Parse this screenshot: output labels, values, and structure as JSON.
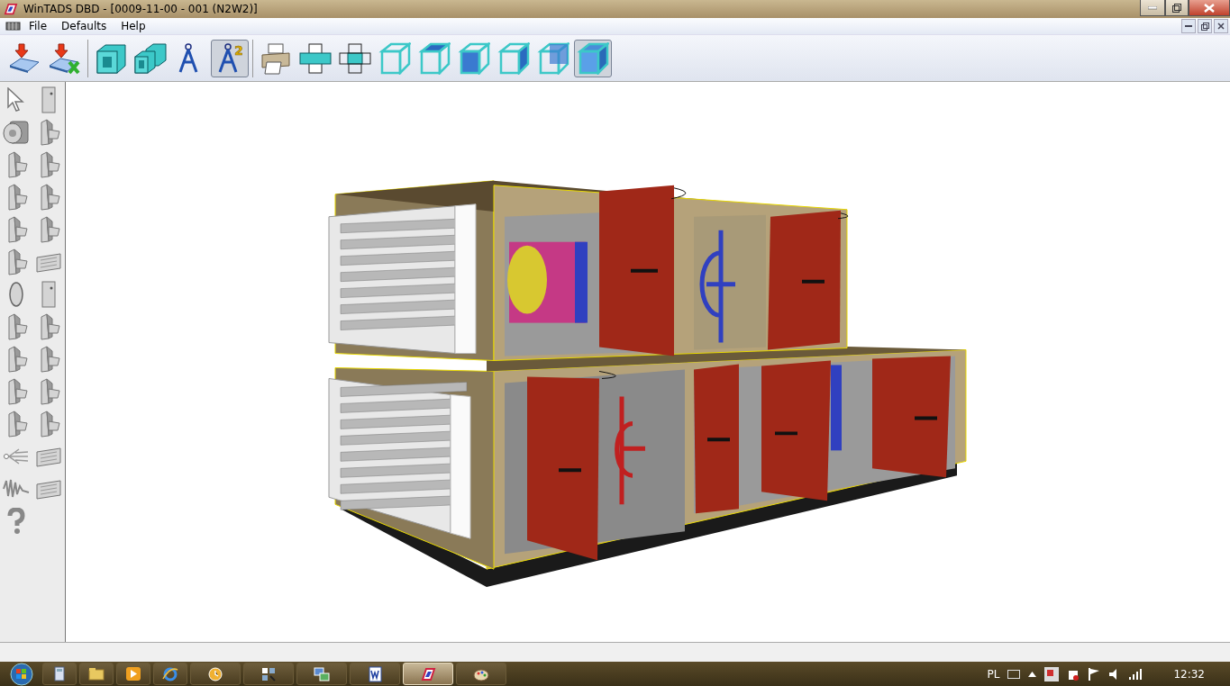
{
  "window": {
    "title": "WinTADS DBD - [0009-11-00 - 001 (N2W2)]"
  },
  "menu": [
    "File",
    "Defaults",
    "Help"
  ],
  "toolbar": {
    "groups": [
      [
        {
          "kind": "save",
          "selected": false
        },
        {
          "kind": "save-cancel",
          "selected": false
        }
      ],
      [
        {
          "kind": "duct",
          "selected": false
        },
        {
          "kind": "duct-double",
          "selected": false
        },
        {
          "kind": "compass",
          "selected": false
        },
        {
          "kind": "compass-badge",
          "badge": "2",
          "selected": true
        }
      ],
      [
        {
          "kind": "print",
          "selected": false
        },
        {
          "kind": "flat-section",
          "selected": false
        },
        {
          "kind": "flat-section-outline",
          "selected": false
        },
        {
          "kind": "wire-box",
          "selected": false
        },
        {
          "kind": "wire-box-top",
          "selected": false
        },
        {
          "kind": "wire-box-front",
          "selected": false
        },
        {
          "kind": "wire-box-side",
          "selected": false
        },
        {
          "kind": "wire-box-back",
          "selected": false
        },
        {
          "kind": "solid-box",
          "selected": true
        }
      ]
    ]
  },
  "palette": [
    {
      "kind": "pointer"
    },
    {
      "kind": "door"
    },
    {
      "kind": "fan"
    },
    {
      "kind": "section"
    },
    {
      "kind": "section"
    },
    {
      "kind": "section"
    },
    {
      "kind": "section"
    },
    {
      "kind": "section"
    },
    {
      "kind": "section"
    },
    {
      "kind": "section"
    },
    {
      "kind": "section"
    },
    {
      "kind": "plate"
    },
    {
      "kind": "disc"
    },
    {
      "kind": "door"
    },
    {
      "kind": "section"
    },
    {
      "kind": "section"
    },
    {
      "kind": "section"
    },
    {
      "kind": "section"
    },
    {
      "kind": "section"
    },
    {
      "kind": "section"
    },
    {
      "kind": "section"
    },
    {
      "kind": "section"
    },
    {
      "kind": "spray"
    },
    {
      "kind": "plate"
    },
    {
      "kind": "wave"
    },
    {
      "kind": "plate"
    },
    {
      "kind": "help"
    }
  ],
  "taskbar": {
    "apps": [
      {
        "kind": "calculator",
        "selected": false
      },
      {
        "kind": "folder",
        "selected": false
      },
      {
        "kind": "media",
        "selected": false
      },
      {
        "kind": "browser",
        "selected": false
      },
      {
        "kind": "clock",
        "selected": false
      },
      {
        "kind": "grid",
        "selected": false
      },
      {
        "kind": "network",
        "selected": false
      },
      {
        "kind": "document",
        "selected": false
      },
      {
        "kind": "wintads",
        "selected": true
      },
      {
        "kind": "paint",
        "selected": false
      }
    ],
    "language": "PL",
    "time": "12:32"
  }
}
